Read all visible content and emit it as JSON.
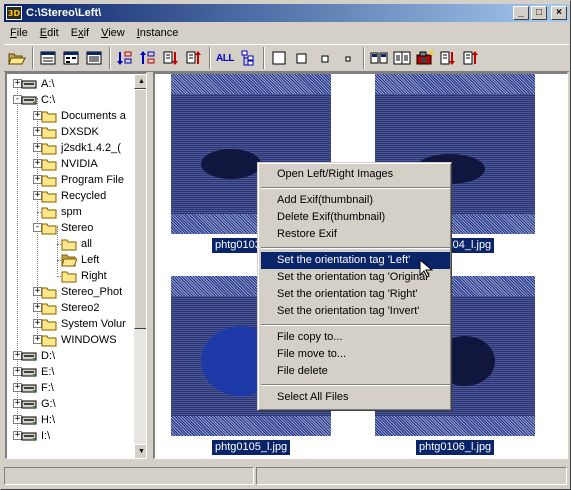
{
  "window": {
    "title": "C:\\Stereo\\Left\\",
    "app_icon_text": "3D",
    "controls": {
      "minimize": "_",
      "maximize": "□",
      "close": "×"
    }
  },
  "menubar": {
    "items": [
      {
        "label": "File",
        "accel": "F"
      },
      {
        "label": "Edit",
        "accel": "E"
      },
      {
        "label": "Exif",
        "accel": "x"
      },
      {
        "label": "View",
        "accel": "V"
      },
      {
        "label": "Instance",
        "accel": "I"
      }
    ]
  },
  "toolbar": {
    "all_label": "ALL",
    "icons": [
      "open-folder-icon",
      "view-details-icon",
      "view-list-icon",
      "view-report-icon",
      "sort-az-icon",
      "sort-date-icon",
      "sort-down-icon",
      "sort-up-icon",
      "all-icon",
      "tree-icon",
      "size-large-icon",
      "size-medium-icon",
      "size-small-icon",
      "size-tiny-icon",
      "compare-icon",
      "stereo-icon",
      "camera-icon",
      "export-icon",
      "import-icon"
    ]
  },
  "tree": {
    "items": [
      {
        "label": "A:\\",
        "type": "floppy",
        "depth": 0,
        "expander": "+"
      },
      {
        "label": "C:\\",
        "type": "drive",
        "depth": 0,
        "expander": "-"
      },
      {
        "label": "Documents a",
        "type": "folder",
        "depth": 1,
        "expander": "+"
      },
      {
        "label": "DXSDK",
        "type": "folder",
        "depth": 1,
        "expander": "+"
      },
      {
        "label": "j2sdk1.4.2_(",
        "type": "folder",
        "depth": 1,
        "expander": "+"
      },
      {
        "label": "NVIDIA",
        "type": "folder",
        "depth": 1,
        "expander": "+"
      },
      {
        "label": "Program File",
        "type": "folder",
        "depth": 1,
        "expander": "+"
      },
      {
        "label": "Recycled",
        "type": "folder",
        "depth": 1,
        "expander": "+"
      },
      {
        "label": "spm",
        "type": "folder",
        "depth": 1,
        "expander": ""
      },
      {
        "label": "Stereo",
        "type": "folder",
        "depth": 1,
        "expander": "-"
      },
      {
        "label": "all",
        "type": "folder",
        "depth": 2,
        "expander": ""
      },
      {
        "label": "Left",
        "type": "folder-open",
        "depth": 2,
        "expander": ""
      },
      {
        "label": "Right",
        "type": "folder",
        "depth": 2,
        "expander": ""
      },
      {
        "label": "Stereo_Phot",
        "type": "folder",
        "depth": 1,
        "expander": "+"
      },
      {
        "label": "Stereo2",
        "type": "folder",
        "depth": 1,
        "expander": "+"
      },
      {
        "label": "System Volur",
        "type": "folder",
        "depth": 1,
        "expander": "+"
      },
      {
        "label": "WINDOWS",
        "type": "folder",
        "depth": 1,
        "expander": "+"
      },
      {
        "label": "D:\\",
        "type": "drive",
        "depth": 0,
        "expander": "+"
      },
      {
        "label": "E:\\",
        "type": "drive",
        "depth": 0,
        "expander": "+"
      },
      {
        "label": "F:\\",
        "type": "drive",
        "depth": 0,
        "expander": "+"
      },
      {
        "label": "G:\\",
        "type": "drive",
        "depth": 0,
        "expander": "+"
      },
      {
        "label": "H:\\",
        "type": "drive",
        "depth": 0,
        "expander": "+"
      },
      {
        "label": "I:\\",
        "type": "drive",
        "depth": 0,
        "expander": "+"
      }
    ]
  },
  "thumbnails": [
    {
      "caption": "phtg0103_l.jpg"
    },
    {
      "caption": "phtg0104_l.jpg"
    },
    {
      "caption": "phtg0105_l.jpg"
    },
    {
      "caption": "phtg0106_l.jpg"
    }
  ],
  "context_menu": {
    "items": [
      {
        "label": "Open Left/Right Images"
      },
      {
        "label": "Add Exif(thumbnail)"
      },
      {
        "label": "Delete Exif(thumbnail)"
      },
      {
        "label": "Restore Exif"
      },
      {
        "label": "Set the orientation tag 'Left'",
        "highlighted": true
      },
      {
        "label": "Set the orientation tag 'Original'"
      },
      {
        "label": "Set the orientation tag 'Right'"
      },
      {
        "label": "Set the orientation tag 'Invert'"
      },
      {
        "label": "File copy to..."
      },
      {
        "label": "File move to..."
      },
      {
        "label": "File delete"
      },
      {
        "label": "Select All Files"
      }
    ]
  },
  "colors": {
    "selection": "#0a246a",
    "face": "#d4d0c8",
    "folder": "#ffe88c"
  }
}
